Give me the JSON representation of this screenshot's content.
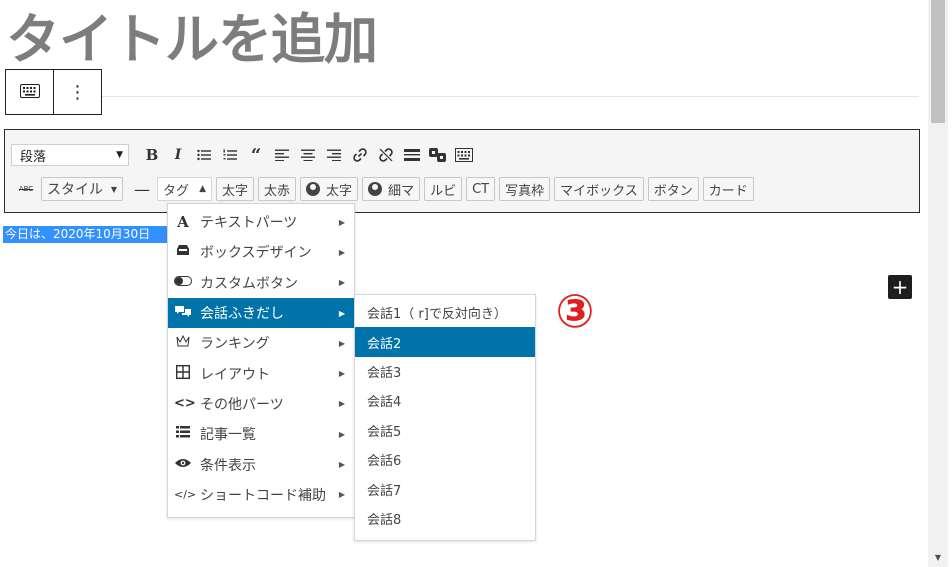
{
  "page": {
    "title": "タイトルを追加"
  },
  "block_toolbar": {
    "keyboard_icon": "keyboard-icon",
    "more_icon": "⋮"
  },
  "editor_toolbar": {
    "format_select": "段落",
    "row1_icons": [
      "bold",
      "italic",
      "bulleted-list",
      "numbered-list",
      "blockquote",
      "align-left",
      "align-center",
      "align-right",
      "link",
      "unlink",
      "more-tag",
      "shortcode",
      "keyboard"
    ],
    "row2": {
      "strikethrough_label": "ABC",
      "style_button": "スタイル",
      "hr_label": "—",
      "tag_button": "タグ",
      "buttons": [
        "太字",
        "太赤",
        "太字",
        "細マ",
        "ルビ",
        "CT",
        "写真枠",
        "マイボックス",
        "ボタン",
        "カード"
      ]
    }
  },
  "content": {
    "selected_text": "今日は、2020年10月30日"
  },
  "tag_menu": {
    "items": [
      {
        "label": "テキストパーツ",
        "icon": "A"
      },
      {
        "label": "ボックスデザイン",
        "icon": "inbox-icon"
      },
      {
        "label": "カスタムボタン",
        "icon": "toggle-icon"
      },
      {
        "label": "会話ふきだし",
        "icon": "comments-icon"
      },
      {
        "label": "ランキング",
        "icon": "crown-icon"
      },
      {
        "label": "レイアウト",
        "icon": "grid-icon"
      },
      {
        "label": "その他パーツ",
        "icon": "code-icon"
      },
      {
        "label": "記事一覧",
        "icon": "list-icon"
      },
      {
        "label": "条件表示",
        "icon": "eye-icon"
      },
      {
        "label": "ショートコード補助",
        "icon": "code-slash-icon"
      }
    ],
    "active_index": 3
  },
  "submenu": {
    "items": [
      "会話1（ r]で反対向き）",
      "会話2",
      "会話3",
      "会話4",
      "会話5",
      "会話6",
      "会話7",
      "会話8"
    ],
    "active_index": 1
  },
  "annotation": "③",
  "plus_button": "+",
  "colors": {
    "accent": "#0073aa",
    "selection": "#3390ff",
    "annotation": "#e02020"
  }
}
